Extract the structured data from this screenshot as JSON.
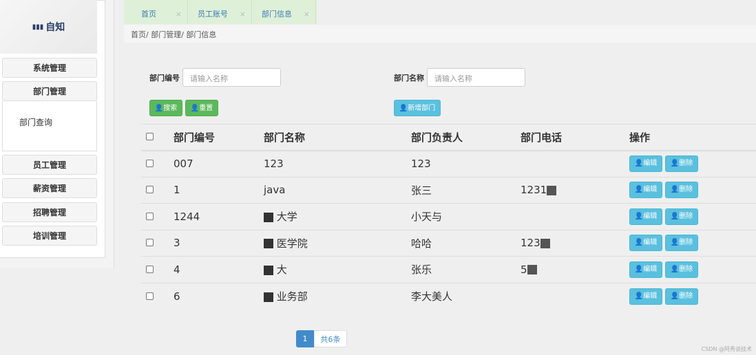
{
  "sidebar": {
    "logo": "自知",
    "items": [
      {
        "label": "系统管理"
      },
      {
        "label": "部门管理"
      },
      {
        "label": "员工管理"
      },
      {
        "label": "薪资管理"
      },
      {
        "label": "招聘管理"
      },
      {
        "label": "培训管理"
      }
    ],
    "sub_item": "部门查询"
  },
  "tabs": [
    {
      "label": "首页"
    },
    {
      "label": "员工账号"
    },
    {
      "label": "部门信息"
    }
  ],
  "close_glyph": "×",
  "breadcrumb": "首页/ 部门管理/ 部门信息",
  "search": {
    "dept_no_label": "部门编号",
    "dept_no_placeholder": "请输入名称",
    "dept_name_label": "部门名称",
    "dept_name_placeholder": "请输入名称",
    "search_btn": "搜索",
    "reset_btn": "重置",
    "add_btn": "新增部门"
  },
  "table": {
    "headers": [
      "部门编号",
      "部门名称",
      "部门负责人",
      "部门电话",
      "操作"
    ],
    "rows": [
      {
        "no": "007",
        "name": "123",
        "leader": "123",
        "phone": ""
      },
      {
        "no": "1",
        "name": "java",
        "leader": "张三",
        "phone": "1231"
      },
      {
        "no": "1244",
        "name": "大学",
        "leader": "小天与",
        "phone": ""
      },
      {
        "no": "3",
        "name": "医学院",
        "leader": "哈哈",
        "phone": "123"
      },
      {
        "no": "4",
        "name": "大",
        "leader": "张乐",
        "phone": "5"
      },
      {
        "no": "6",
        "name": "业务部",
        "leader": "李大美人",
        "phone": ""
      }
    ],
    "edit_label": "编辑",
    "delete_label": "删除"
  },
  "pagination": {
    "current": "1",
    "total": "共6条"
  },
  "watermark": "CSDN @阿秀谈技术"
}
